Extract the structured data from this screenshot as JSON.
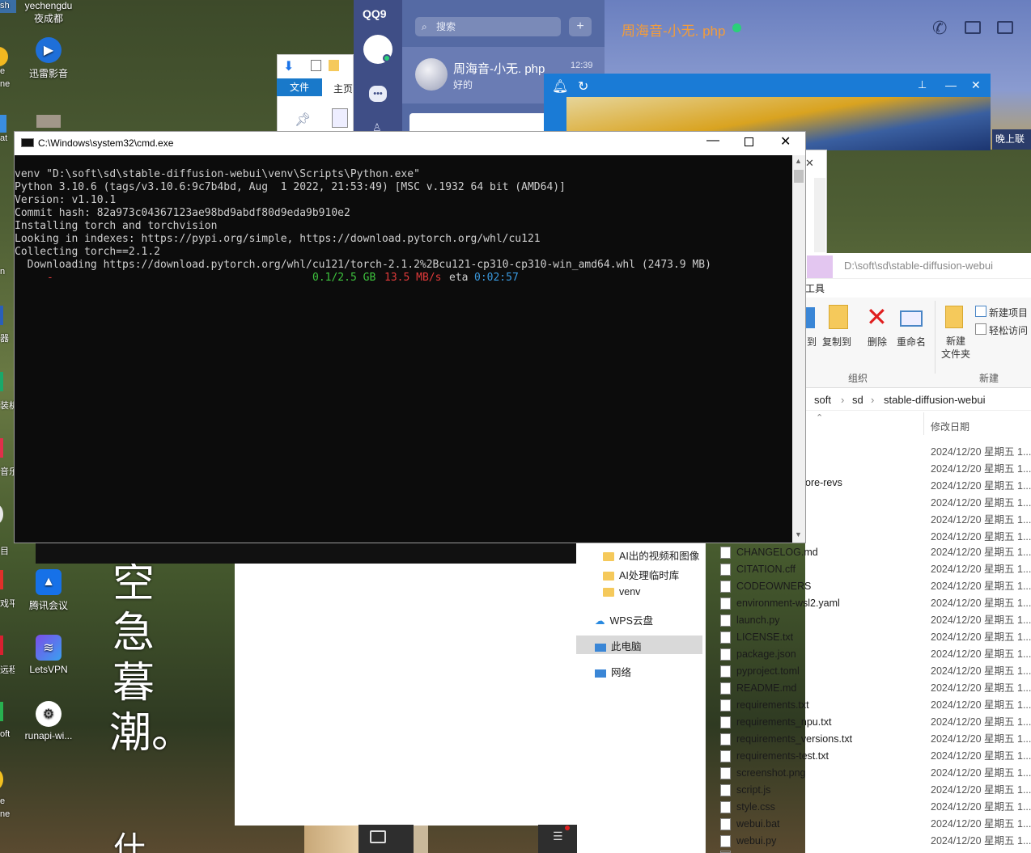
{
  "desktop": {
    "top_user": "yechengdu",
    "top_user_sub": "夜成都",
    "icons": [
      {
        "label": "迅雷影音",
        "icon": "xunlei-icon"
      },
      {
        "label": "腾讯会议",
        "icon": "tencent-meeting-icon"
      },
      {
        "label": "LetsVPN",
        "icon": "letsvpn-icon"
      },
      {
        "label": "runapi-wi...",
        "icon": "runapi-icon"
      }
    ],
    "left_strip_labels": [
      "sh",
      "e",
      "ne",
      "at",
      "n",
      "器",
      "装机",
      "音乐",
      "目",
      "戏平",
      "远程",
      "oft",
      "e",
      "ne"
    ],
    "calligraphy": "空急暮潮。",
    "calligraphy_bottom": "什"
  },
  "qq": {
    "logo": "QQ9",
    "search_placeholder": "搜索",
    "plus": "+",
    "contact_name": "周海音-小无. php",
    "contact_time": "12:39",
    "contact_msg": "好的",
    "chat_title": "周海音-小无. php",
    "corner_text": "晚上联"
  },
  "explorer_small": {
    "tab_file": "文件",
    "tab_home": "主页"
  },
  "cmd": {
    "title": "C:\\Windows\\system32\\cmd.exe",
    "lines": [
      "venv \"D:\\soft\\sd\\stable-diffusion-webui\\venv\\Scripts\\Python.exe\"",
      "Python 3.10.6 (tags/v3.10.6:9c7b4bd, Aug  1 2022, 21:53:49) [MSC v.1932 64 bit (AMD64)]",
      "Version: v1.10.1",
      "Commit hash: 82a973c04367123ae98bd9abdf80d9eda9b910e2",
      "Installing torch and torchvision",
      "Looking in indexes: https://pypi.org/simple, https://download.pytorch.org/whl/cu121",
      "Collecting torch==2.1.2",
      "  Downloading https://download.pytorch.org/whl/cu121/torch-2.1.2%2Bcu121-cp310-cp310-win_amd64.whl (2473.9 MB)"
    ],
    "progress_dash": "-",
    "progress_size": "0.1/2.5 GB",
    "progress_speed": "13.5 MB/s",
    "progress_eta_label": "eta",
    "progress_eta": "0:02:57",
    "progress_fraction": 0.04
  },
  "explorer": {
    "path_title": "D:\\soft\\sd\\stable-diffusion-webui",
    "ribbon_tab": "工具",
    "ribbon": {
      "move_to": "到",
      "copy_to": "复制到",
      "delete": "删除",
      "rename": "重命名",
      "new_folder": "新建\n文件夹",
      "new_item": "新建项目",
      "easy_access": "轻松访问",
      "group_organize": "组织",
      "group_new": "新建"
    },
    "breadcrumb": [
      "soft",
      "sd",
      "stable-diffusion-webui"
    ],
    "column_modified": "修改日期",
    "nav": [
      {
        "label": "AI出的视频和图像",
        "type": "folder"
      },
      {
        "label": "AI处理临时库",
        "type": "folder"
      },
      {
        "label": "venv",
        "type": "folder"
      },
      {
        "label": "WPS云盘",
        "type": "cloud"
      },
      {
        "label": "此电脑",
        "type": "pc"
      },
      {
        "label": "网络",
        "type": "network"
      }
    ],
    "partial_row": "ore-revs",
    "date": "2024/12/20 星期五 1...",
    "files": [
      "CHANGELOG.md",
      "CITATION.cff",
      "CODEOWNERS",
      "environment-wsl2.yaml",
      "launch.py",
      "LICENSE.txt",
      "package.json",
      "pyproject.toml",
      "README.md",
      "requirements.txt",
      "requirements_npu.txt",
      "requirements_versions.txt",
      "requirements-test.txt",
      "screenshot.png",
      "script.js",
      "style.css",
      "webui.bat",
      "webui.py"
    ]
  }
}
